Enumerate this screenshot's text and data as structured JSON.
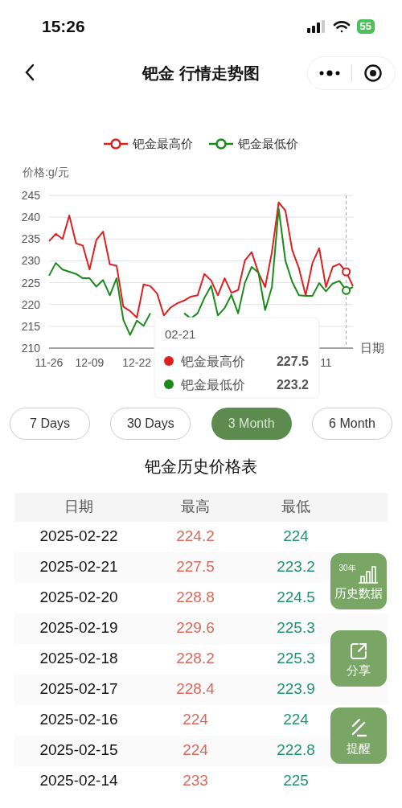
{
  "status_bar": {
    "time": "15:26",
    "battery": "55"
  },
  "nav": {
    "title": "钯金 行情走势图"
  },
  "chart": {
    "chart_data": {
      "type": "line",
      "ylabel": "价格:g/元",
      "xlabel": "日期",
      "categories": [
        "11-26",
        null,
        null,
        null,
        null,
        null,
        "12-09",
        null,
        null,
        null,
        null,
        null,
        null,
        "12-22",
        null,
        null,
        null,
        null,
        null,
        null,
        null,
        null,
        null,
        null,
        null,
        null,
        null,
        null,
        null,
        null,
        null,
        null,
        null,
        null,
        null,
        null,
        null,
        null,
        null,
        null,
        null,
        "11",
        null,
        null,
        null,
        null
      ],
      "series": [
        {
          "name": "钯金最高价",
          "color": "#e02020",
          "values": [
            234.5,
            236.2,
            235,
            240.4,
            234,
            233.5,
            228,
            234.8,
            236.7,
            229.2,
            228.9,
            219.5,
            218.5,
            217,
            224.6,
            224.2,
            222.5,
            217.5,
            219.3,
            220.3,
            220.9,
            221.8,
            222.1,
            227,
            225.5,
            222.1,
            226,
            222.7,
            223.3,
            230.1,
            232,
            227.3,
            224,
            232,
            243.4,
            241.5,
            232.5,
            228.3,
            222.1,
            229.5,
            232.9,
            224,
            228.6,
            229.3,
            227.5,
            224.2
          ]
        },
        {
          "name": "钯金最低价",
          "color": "#1a8a1a",
          "values": [
            226.6,
            229.5,
            228,
            227.5,
            227,
            226,
            226,
            224.1,
            225.6,
            222.1,
            226,
            216.5,
            213,
            216.3,
            215.1,
            218,
            null,
            null,
            null,
            null,
            218,
            216.8,
            218,
            221.5,
            224.3,
            217.5,
            219.2,
            222.2,
            218,
            225,
            228.6,
            227.3,
            218.7,
            224,
            242,
            230,
            225.2,
            222.1,
            222,
            222,
            224.9,
            223,
            224.8,
            225.4,
            223.2,
            224
          ]
        }
      ],
      "ylim": [
        210,
        245
      ],
      "yticks": [
        210,
        215,
        220,
        225,
        230,
        235,
        240,
        245
      ],
      "grid": true,
      "legend": true
    },
    "tooltip": {
      "title": "02-21",
      "rows": [
        {
          "name": "钯金最高价",
          "value": "227.5",
          "color": "#e02020"
        },
        {
          "name": "钯金最低价",
          "value": "223.2",
          "color": "#1a8a1a"
        }
      ]
    }
  },
  "ranges": [
    {
      "label": "7 Days",
      "selected": false
    },
    {
      "label": "30 Days",
      "selected": false
    },
    {
      "label": "3 Month",
      "selected": true
    },
    {
      "label": "6 Month",
      "selected": false
    }
  ],
  "table": {
    "title": "钯金历史价格表",
    "columns": [
      "日期",
      "最高",
      "最低"
    ],
    "rows": [
      [
        "2025-02-22",
        "224.2",
        "224"
      ],
      [
        "2025-02-21",
        "227.5",
        "223.2"
      ],
      [
        "2025-02-20",
        "228.8",
        "224.5"
      ],
      [
        "2025-02-19",
        "229.6",
        "225.3"
      ],
      [
        "2025-02-18",
        "228.2",
        "225.3"
      ],
      [
        "2025-02-17",
        "228.4",
        "223.9"
      ],
      [
        "2025-02-16",
        "224",
        "224"
      ],
      [
        "2025-02-15",
        "224",
        "222.8"
      ],
      [
        "2025-02-14",
        "233",
        "225"
      ]
    ]
  },
  "float_buttons": [
    {
      "kind": "history",
      "label": "历史数据",
      "badge": "30年"
    },
    {
      "kind": "share",
      "label": "分享"
    },
    {
      "kind": "remind",
      "label": "提醒"
    }
  ]
}
